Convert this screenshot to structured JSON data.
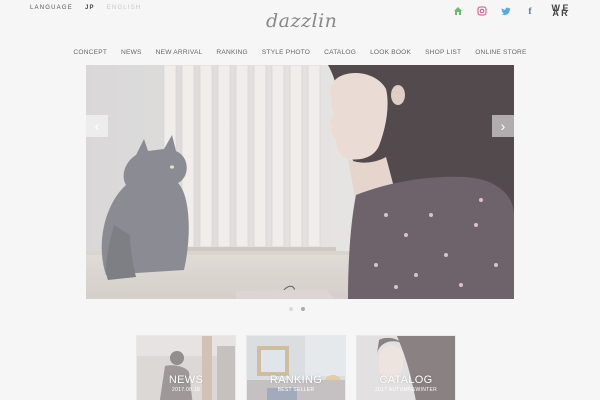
{
  "header": {
    "language_label": "LANGUAGE",
    "lang_jp": "JP",
    "lang_en": "ENGLISH",
    "logo_text": "dazzlin",
    "social": {
      "home_icon": "⌂",
      "instagram_icon": "◎",
      "twitter_icon": "🕊",
      "facebook_icon": "f",
      "wear_label": "W E A R"
    }
  },
  "nav": {
    "items": [
      "CONCEPT",
      "NEWS",
      "NEW ARRIVAL",
      "RANKING",
      "STYLE PHOTO",
      "CATALOG",
      "LOOK BOOK",
      "SHOP LIST",
      "ONLINE STORE"
    ]
  },
  "slider": {
    "prev_glyph": "‹",
    "next_glyph": "›",
    "slide_count": 2,
    "active_slide": 2
  },
  "cards": [
    {
      "title": "NEWS",
      "subtitle": "2017.08.18"
    },
    {
      "title": "RANKING",
      "subtitle": "BEST SELLER"
    },
    {
      "title": "CATALOG",
      "subtitle": "2017 AUTUMN&WINTER"
    }
  ],
  "colors": {
    "home": "#6cbb6c",
    "instagram": "#d64a8a",
    "twitter": "#58a9dd",
    "facebook": "#4a6aa8"
  }
}
